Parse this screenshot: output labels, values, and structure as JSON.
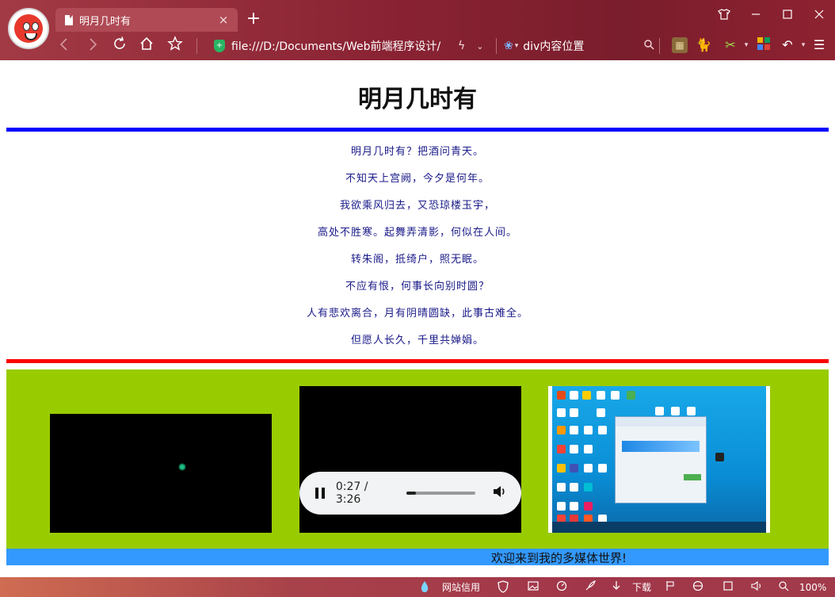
{
  "browser": {
    "tab_title": "明月几时有",
    "tab_close": "×",
    "new_tab": "+",
    "address": "file:///D:/Documents/Web前端程序设计/",
    "search_text": "div内容位置",
    "zoom": "100%",
    "status_items": [
      "网站信用",
      "下载"
    ],
    "window_buttons": [
      "tshirt-icon",
      "minimize-icon",
      "maximize-icon",
      "close-icon"
    ]
  },
  "page": {
    "heading": "明月几时有",
    "poem": [
      "明月几时有？把酒问青天。",
      "不知天上宫阙，今夕是何年。",
      "我欲乘风归去，又恐琼楼玉宇，",
      "高处不胜寒。起舞弄清影，何似在人间。",
      "转朱阁，抵绮户，照无眠。",
      "不应有恨，何事长向别时圆？",
      "人有悲欢离合，月有阴晴圆缺，此事古难全。",
      "但愿人长久，千里共婵娟。"
    ],
    "audio_time": "0:27 / 3:26",
    "audio_progress": 0.131,
    "banner": "欢迎来到我的多媒体世界!",
    "colors": {
      "rule_top": "#0000ff",
      "rule_bottom": "#ff0000",
      "media_bg": "#99cc00",
      "banner_bg": "#3399ff"
    }
  }
}
